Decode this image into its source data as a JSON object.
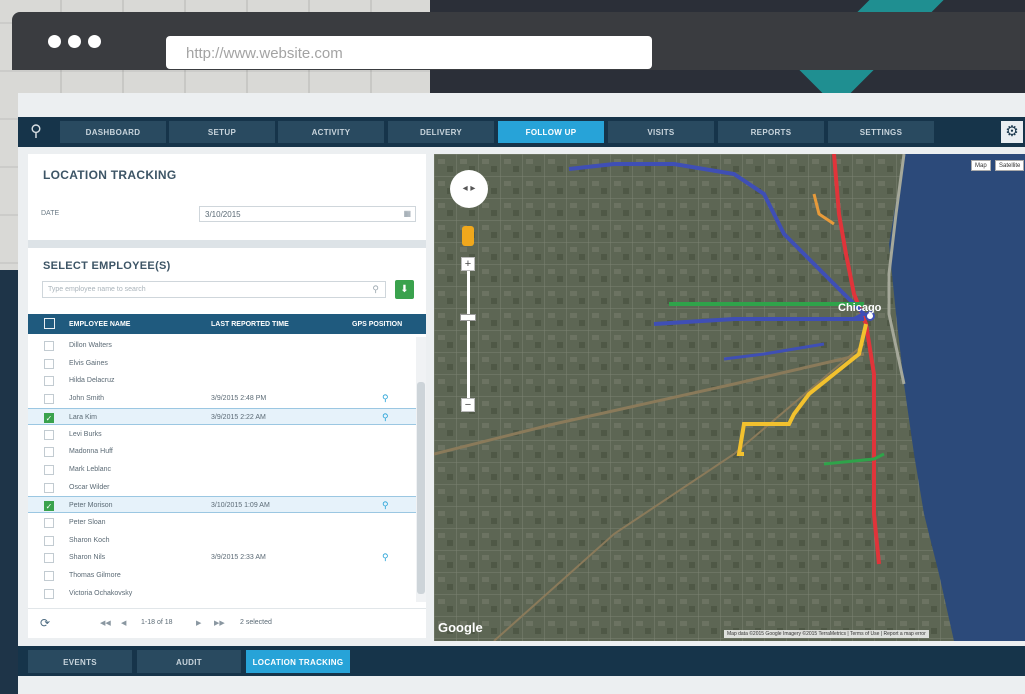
{
  "browser": {
    "url": "http://www.website.com"
  },
  "nav": {
    "tabs": [
      "DASHBOARD",
      "SETUP",
      "ACTIVITY",
      "DELIVERY",
      "FOLLOW UP",
      "VISITS",
      "REPORTS",
      "SETTINGS"
    ],
    "active_tab": "FOLLOW UP",
    "logo_icon": "map-pin-icon",
    "settings_icon": "gear-icon"
  },
  "location_tracking": {
    "title": "LOCATION TRACKING",
    "date_label": "DATE",
    "date_value": "3/10/2015"
  },
  "employees": {
    "title": "SELECT EMPLOYEE(S)",
    "search_placeholder": "Type employee name to search",
    "columns": [
      "EMPLOYEE NAME",
      "LAST REPORTED TIME",
      "GPS POSITION"
    ],
    "rows": [
      {
        "name": "Dillon Walters",
        "time": "",
        "checked": false,
        "pin": false
      },
      {
        "name": "Elvis Gaines",
        "time": "",
        "checked": false,
        "pin": false
      },
      {
        "name": "Hilda Delacruz",
        "time": "",
        "checked": false,
        "pin": false
      },
      {
        "name": "John Smith",
        "time": "3/9/2015 2:48 PM",
        "checked": false,
        "pin": true
      },
      {
        "name": "Lara Kim",
        "time": "3/9/2015 2:22 AM",
        "checked": true,
        "pin": true
      },
      {
        "name": "Levi Burks",
        "time": "",
        "checked": false,
        "pin": false
      },
      {
        "name": "Madonna Huff",
        "time": "",
        "checked": false,
        "pin": false
      },
      {
        "name": "Mark Leblanc",
        "time": "",
        "checked": false,
        "pin": false
      },
      {
        "name": "Oscar Wilder",
        "time": "",
        "checked": false,
        "pin": false
      },
      {
        "name": "Peter Morison",
        "time": "3/10/2015 1:09 AM",
        "checked": true,
        "pin": true
      },
      {
        "name": "Peter Sloan",
        "time": "",
        "checked": false,
        "pin": false
      },
      {
        "name": "Sharon Koch",
        "time": "",
        "checked": false,
        "pin": false
      },
      {
        "name": "Sharon Nils",
        "time": "3/9/2015 2:33 AM",
        "checked": false,
        "pin": true
      },
      {
        "name": "Thomas Gilmore",
        "time": "",
        "checked": false,
        "pin": false
      },
      {
        "name": "Victoria Ochakovsky",
        "time": "",
        "checked": false,
        "pin": false
      }
    ],
    "pager": {
      "range": "1-18 of 18",
      "selected": "2 selected"
    }
  },
  "map": {
    "map_type_options": [
      "Map",
      "Satellite"
    ],
    "selected_type": "Satellite",
    "city_label": "Chicago",
    "logo_text": "Google",
    "attribution": "Map data ©2015 Google Imagery ©2015 TerraMetrics | Terms of Use | Report a map error",
    "route_colors": [
      "#e0343a",
      "#f2c12e",
      "#3f4fb5",
      "#2fa34a",
      "#e79a3a"
    ]
  },
  "bottom_tabs": {
    "tabs": [
      "EVENTS",
      "AUDIT",
      "LOCATION TRACKING"
    ],
    "active_tab": "LOCATION TRACKING"
  }
}
